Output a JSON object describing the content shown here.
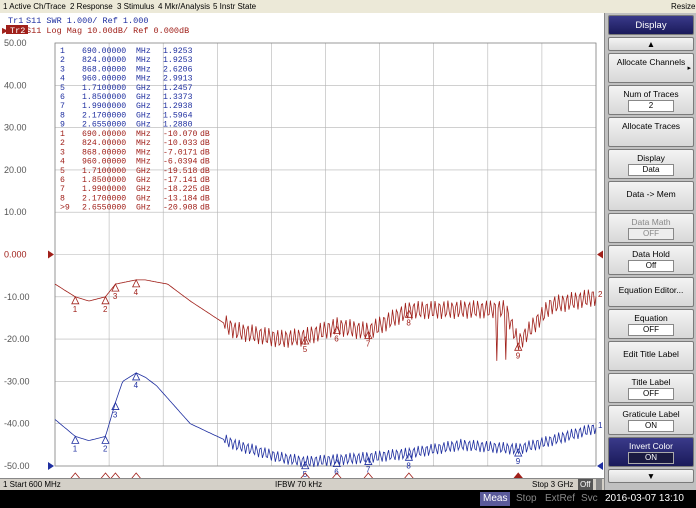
{
  "menu": [
    "1 Active Ch/Trace",
    "2 Response",
    "3 Stimulus",
    "4 Mkr/Analysis",
    "5 Instr State",
    "Resize"
  ],
  "traces": {
    "tr1_label": "Tr1",
    "tr1_info": " S11  SWR 1.000/ Ref 1.000",
    "tr2_label": "Tr2",
    "tr2_info": " S11  Log Mag 10.00dB/ Ref 0.000dB"
  },
  "y_ticks": [
    "50.00",
    "40.00",
    "30.00",
    "20.00",
    "10.00",
    "0.000",
    "-10.00",
    "-20.00",
    "-30.00",
    "-40.00",
    "-50.00"
  ],
  "markers_tr1": [
    {
      "n": "1",
      "f": "690.00000",
      "u": "MHz",
      "v": "1.9253"
    },
    {
      "n": "2",
      "f": "824.00000",
      "u": "MHz",
      "v": "1.9253"
    },
    {
      "n": "3",
      "f": "868.00000",
      "u": "MHz",
      "v": "2.6206"
    },
    {
      "n": "4",
      "f": "960.00000",
      "u": "MHz",
      "v": "2.9913"
    },
    {
      "n": "5",
      "f": "1.7100000",
      "u": "GHz",
      "v": "1.2457"
    },
    {
      "n": "6",
      "f": "1.8500000",
      "u": "GHz",
      "v": "1.3373"
    },
    {
      "n": "7",
      "f": "1.9900000",
      "u": "GHz",
      "v": "1.2938"
    },
    {
      "n": "8",
      "f": "2.1700000",
      "u": "GHz",
      "v": "1.5964"
    },
    {
      "n": "9",
      "f": "2.6550000",
      "u": "GHz",
      "v": "1.2880"
    }
  ],
  "markers_tr2": [
    {
      "n": "1",
      "f": "690.00000",
      "u": "MHz",
      "v": "-10.070",
      "unit": "dB"
    },
    {
      "n": "2",
      "f": "824.00000",
      "u": "MHz",
      "v": "-10.033",
      "unit": "dB"
    },
    {
      "n": "3",
      "f": "868.00000",
      "u": "MHz",
      "v": "-7.0171",
      "unit": "dB"
    },
    {
      "n": "4",
      "f": "960.00000",
      "u": "MHz",
      "v": "-6.0394",
      "unit": "dB"
    },
    {
      "n": "5",
      "f": "1.7100000",
      "u": "GHz",
      "v": "-19.518",
      "unit": "dB"
    },
    {
      "n": "6",
      "f": "1.8500000",
      "u": "GHz",
      "v": "-17.141",
      "unit": "dB"
    },
    {
      "n": "7",
      "f": "1.9900000",
      "u": "GHz",
      "v": "-18.225",
      "unit": "dB"
    },
    {
      "n": "8",
      "f": "2.1700000",
      "u": "GHz",
      "v": "-13.184",
      "unit": "dB"
    },
    {
      "n": ">9",
      "f": "2.6550000",
      "u": "GHz",
      "v": "-20.908",
      "unit": "dB"
    }
  ],
  "status": {
    "start": "1  Start 600 MHz",
    "ifbw": "IFBW 70 kHz",
    "stop": "Stop 3 GHz",
    "off": "Off"
  },
  "bottom": {
    "meas": "Meas",
    "stop": "Stop",
    "extref": "ExtRef",
    "svc": "Svc",
    "datetime": "2016-03-07 13:10"
  },
  "softkeys": {
    "title": "Display",
    "allocate_channels": "Allocate Channels",
    "num_traces": "Num of Traces",
    "num_traces_value": "2",
    "allocate_traces": "Allocate Traces",
    "display": "Display",
    "display_value": "Data",
    "data_to_mem": "Data -> Mem",
    "data_math": "Data Math",
    "data_math_value": "OFF",
    "data_hold": "Data Hold",
    "data_hold_value": "Off",
    "equation_editor": "Equation Editor...",
    "equation": "Equation",
    "equation_value": "OFF",
    "edit_title": "Edit Title Label",
    "title_label": "Title Label",
    "title_label_value": "OFF",
    "graticule_label": "Graticule Label",
    "graticule_label_value": "ON",
    "invert_color": "Invert Color",
    "invert_color_value": "ON"
  },
  "colors": {
    "tr1": "#1f2fa0",
    "tr2": "#a0201a",
    "grid": "#b4b4b4"
  },
  "chart_data": {
    "type": "line",
    "x_range_ghz": [
      0.6,
      3.0
    ],
    "ylim": [
      -50,
      50
    ],
    "series": [
      {
        "name": "Tr1",
        "points": [
          [
            0.6,
            -39
          ],
          [
            0.69,
            -43
          ],
          [
            0.75,
            -44
          ],
          [
            0.824,
            -43
          ],
          [
            0.868,
            -35
          ],
          [
            0.9,
            -30
          ],
          [
            0.96,
            -28
          ],
          [
            1.0,
            -29
          ],
          [
            1.05,
            -31
          ],
          [
            1.2,
            -40
          ],
          [
            1.4,
            -45
          ],
          [
            1.6,
            -48
          ],
          [
            1.71,
            -49
          ],
          [
            1.85,
            -48.5
          ],
          [
            1.99,
            -48
          ],
          [
            2.17,
            -47
          ],
          [
            2.4,
            -45
          ],
          [
            2.655,
            -46
          ],
          [
            2.8,
            -44
          ],
          [
            3.0,
            -41
          ]
        ]
      },
      {
        "name": "Tr2",
        "points": [
          [
            0.6,
            -7
          ],
          [
            0.69,
            -10
          ],
          [
            0.75,
            -11
          ],
          [
            0.824,
            -10
          ],
          [
            0.868,
            -7
          ],
          [
            0.96,
            -6
          ],
          [
            1.0,
            -6
          ],
          [
            1.1,
            -7
          ],
          [
            1.2,
            -11
          ],
          [
            1.4,
            -18
          ],
          [
            1.6,
            -20
          ],
          [
            1.71,
            -19.5
          ],
          [
            1.85,
            -17
          ],
          [
            1.99,
            -18.2
          ],
          [
            2.17,
            -13.2
          ],
          [
            2.4,
            -13
          ],
          [
            2.6,
            -13
          ],
          [
            2.655,
            -21
          ],
          [
            2.8,
            -12
          ],
          [
            3.0,
            -10
          ]
        ]
      }
    ]
  }
}
